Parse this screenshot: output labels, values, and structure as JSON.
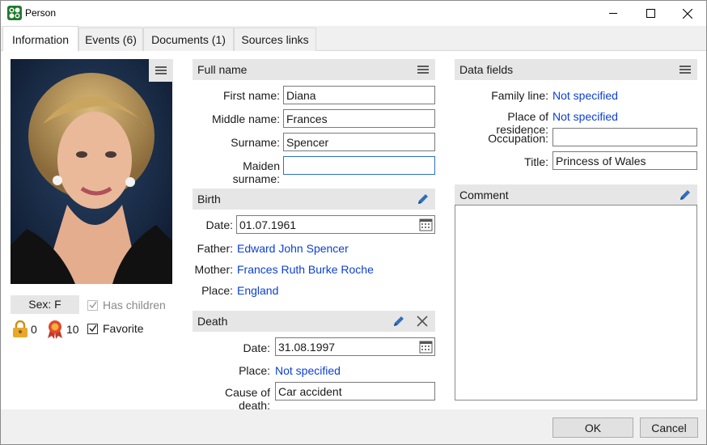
{
  "window": {
    "title": "Person"
  },
  "tabs": [
    {
      "label": "Information"
    },
    {
      "label": "Events (6)"
    },
    {
      "label": "Documents (1)"
    },
    {
      "label": "Sources links"
    }
  ],
  "left": {
    "sex_label": "Sex: F",
    "has_children_label": "Has children",
    "has_children_checked": true,
    "favorite_label": "Favorite",
    "favorite_checked": true,
    "lock_count": "0",
    "award_count": "10"
  },
  "full_name": {
    "header": "Full name",
    "first_name_label": "First name:",
    "first_name": "Diana",
    "middle_name_label": "Middle name:",
    "middle_name": "Frances",
    "surname_label": "Surname:",
    "surname": "Spencer",
    "maiden_label": "Maiden surname:",
    "maiden": ""
  },
  "birth": {
    "header": "Birth",
    "date_label": "Date:",
    "date": "01.07.1961",
    "father_label": "Father:",
    "father": "Edward John Spencer",
    "mother_label": "Mother:",
    "mother": "Frances Ruth Burke Roche",
    "place_label": "Place:",
    "place": "England"
  },
  "death": {
    "header": "Death",
    "date_label": "Date:",
    "date": "31.08.1997",
    "place_label": "Place:",
    "place": "Not specified",
    "cause_label": "Cause of death:",
    "cause": "Car accident"
  },
  "data_fields": {
    "header": "Data fields",
    "family_line_label": "Family line:",
    "family_line": "Not specified",
    "residence_label": "Place of residence:",
    "residence": "Not specified",
    "occupation_label": "Occupation:",
    "occupation": "",
    "title_label": "Title:",
    "title": "Princess of Wales"
  },
  "comment": {
    "header": "Comment",
    "text": ""
  },
  "footer": {
    "ok_label": "OK",
    "cancel_label": "Cancel"
  },
  "colors": {
    "link": "#0b3fd6",
    "header_bg": "#e6e6e6",
    "accent_icon": "#2f6fbd"
  }
}
